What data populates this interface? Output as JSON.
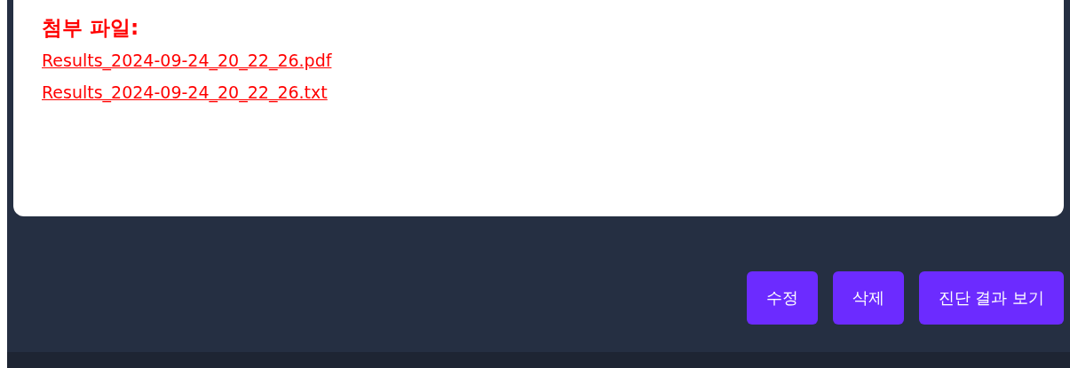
{
  "attachments": {
    "heading": "첨부 파일:",
    "files": [
      "Results_2024-09-24_20_22_26.pdf",
      "Results_2024-09-24_20_22_26.txt"
    ]
  },
  "buttons": [
    {
      "label": "수정"
    },
    {
      "label": "삭제"
    },
    {
      "label": "진단 결과 보기"
    }
  ]
}
